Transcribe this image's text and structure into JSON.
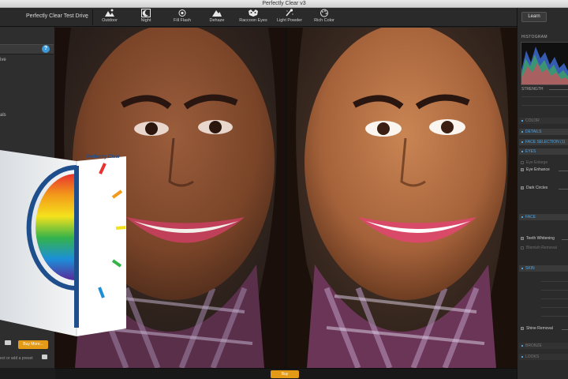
{
  "window": {
    "title": "Perfectly Clear v3"
  },
  "toolbar": {
    "preset_name": "Perfectly Clear Test Drive",
    "tools": [
      {
        "label": "Outdoor",
        "icon": "outdoor-icon"
      },
      {
        "label": "Night",
        "icon": "night-icon"
      },
      {
        "label": "Fill Flash",
        "icon": "fill-flash-icon"
      },
      {
        "label": "Dehaze",
        "icon": "dehaze-icon"
      },
      {
        "label": "Raccoon Eyes",
        "icon": "raccoon-eyes-icon"
      },
      {
        "label": "Light Powder",
        "icon": "light-powder-icon"
      },
      {
        "label": "Rich Color",
        "icon": "rich-color-icon"
      }
    ]
  },
  "sidebar": {
    "items": [
      "ive",
      "als"
    ],
    "help_glyph": "?",
    "buy_more_label": "Buy More...",
    "hint_text": "ect or add a preset"
  },
  "panel": {
    "learn_label": "Learn",
    "histogram_label": "HISTOGRAM",
    "strength_label": "STRENGTH",
    "sections": [
      {
        "label": "COLOR",
        "state": "dim"
      },
      {
        "label": "DETAILS",
        "state": "blue"
      },
      {
        "label": "FACE SELECTION (1)",
        "state": "blue"
      },
      {
        "label": "EYES",
        "state": "blue"
      },
      {
        "label": "FACE",
        "state": "blue"
      },
      {
        "label": "SKIN",
        "state": "blue"
      },
      {
        "label": "BRONZE",
        "state": "dim"
      },
      {
        "label": "LOOKS",
        "state": "dim"
      }
    ],
    "eyes_options": [
      {
        "label": "Eye Enlarge",
        "checked": false
      },
      {
        "label": "Eye Enhance",
        "checked": true
      },
      {
        "label": "Dark Circles",
        "checked": true
      }
    ],
    "face_options": [
      {
        "label": "Teeth Whitening",
        "checked": true
      },
      {
        "label": "Blemish Removal",
        "checked": false
      },
      {
        "label": "Shine Removal",
        "checked": true
      }
    ]
  },
  "bottom": {
    "buy_label": "Buy"
  },
  "product_box": {
    "brand": "Perfectly Clear"
  },
  "colors": {
    "accent_orange": "#e39a16",
    "accent_blue": "#4fa3e0",
    "help_blue": "#3c9ad8"
  }
}
